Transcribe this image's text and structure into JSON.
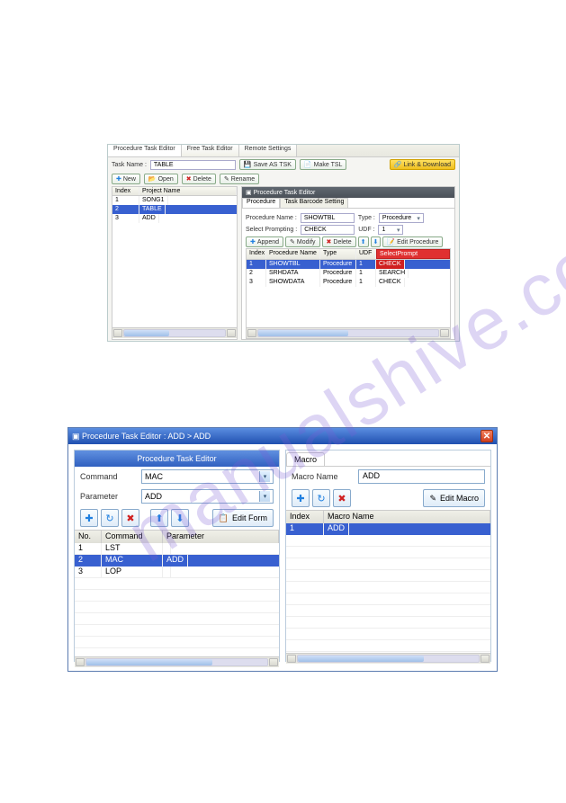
{
  "win1": {
    "tabs": [
      "Procedure Task Editor",
      "Free Task Editor",
      "Remote Settings"
    ],
    "task_name_label": "Task Name :",
    "task_name_value": "TABLE",
    "btn_save_tsk": "Save AS TSK",
    "btn_make_tsl": "Make TSL",
    "btn_link_download": "Link & Download",
    "btn_new": "New",
    "btn_open": "Open",
    "btn_delete": "Delete",
    "btn_rename": "Rename",
    "left_headers": [
      "Index",
      "Project Name"
    ],
    "left_rows": [
      {
        "index": "1",
        "name": "SONG1"
      },
      {
        "index": "2",
        "name": "TABLE"
      },
      {
        "index": "3",
        "name": "ADD"
      }
    ],
    "editor_title": "Procedure Task Editor",
    "editor_tabs": [
      "Procedure",
      "Task Barcode Setting"
    ],
    "proc_name_label": "Procedure Name :",
    "proc_name_value": "SHOWTBL",
    "type_label": "Type :",
    "type_value": "Procedure",
    "select_prompting_label": "Select Prompting :",
    "select_prompting_value": "CHECK",
    "udf_label": "UDF :",
    "udf_value": "1",
    "btn_append": "Append",
    "btn_modify": "Modify",
    "btn_delete2": "Delete",
    "btn_edit_procedure": "Edit Procedure",
    "right_headers": [
      "Index",
      "Procedure Name",
      "Type",
      "UDF",
      "SelectPrompt"
    ],
    "right_rows": [
      {
        "index": "1",
        "name": "SHOWTBL",
        "type": "Procedure",
        "udf": "1",
        "sp": "CHECK"
      },
      {
        "index": "2",
        "name": "SRHDATA",
        "type": "Procedure",
        "udf": "1",
        "sp": "SEARCH"
      },
      {
        "index": "3",
        "name": "SHOWDATA",
        "type": "Procedure",
        "udf": "1",
        "sp": "CHECK"
      }
    ]
  },
  "win2": {
    "title": "Procedure Task Editor : ADD > ADD",
    "left_pane_title": "Procedure Task Editor",
    "command_label": "Command",
    "command_value": "MAC",
    "parameter_label": "Parameter",
    "parameter_value": "ADD",
    "btn_edit_form": "Edit Form",
    "grid_headers": [
      "No.",
      "Command",
      "Parameter"
    ],
    "grid_rows": [
      {
        "no": "1",
        "cmd": "LST",
        "param": ""
      },
      {
        "no": "2",
        "cmd": "MAC",
        "param": "ADD"
      },
      {
        "no": "3",
        "cmd": "LOP",
        "param": ""
      }
    ],
    "macro_tab": "Macro",
    "macro_name_label": "Macro Name",
    "macro_name_value": "ADD",
    "btn_edit_macro": "Edit Macro",
    "macro_headers": [
      "Index",
      "Macro Name"
    ],
    "macro_rows": [
      {
        "index": "1",
        "name": "ADD"
      }
    ]
  }
}
